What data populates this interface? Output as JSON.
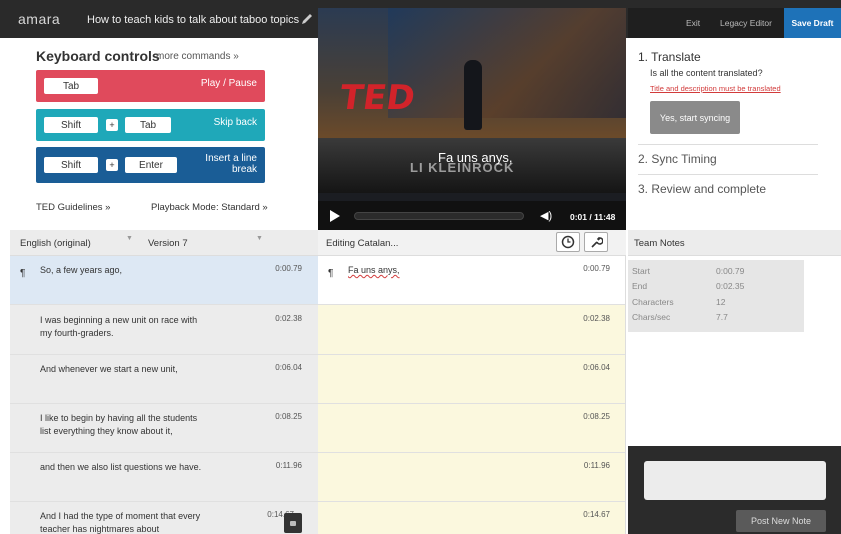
{
  "topbar": {
    "logo": "amara",
    "video_title": "How to teach kids to talk about taboo topics",
    "exit": "Exit",
    "legacy_editor": "Legacy Editor",
    "save_draft": "Save Draft"
  },
  "keyboard": {
    "title": "Keyboard controls",
    "more": "more commands »",
    "rows": [
      {
        "keys": [
          "Tab"
        ],
        "action": "Play / Pause",
        "color": "#e04a5c"
      },
      {
        "keys": [
          "Shift",
          "Tab"
        ],
        "action": "Skip back",
        "color": "#1fa8b9"
      },
      {
        "keys": [
          "Shift",
          "Enter"
        ],
        "action_line1": "Insert a line",
        "action_line2": "break",
        "color": "#1a5d96"
      }
    ],
    "plus": "+",
    "ted_guidelines": "TED Guidelines »",
    "playback_mode": "Playback Mode: Standard »"
  },
  "video": {
    "caption": "Fa uns anys,",
    "brand": "TED",
    "watermark": "LI KLEINROCK",
    "time": "0:01 / 11:48",
    "volume_icon": "volume-icon",
    "play_icon": "play-icon"
  },
  "workflow": {
    "step1": "1. Translate",
    "step1_question": "Is all the content translated?",
    "step1_warning": "Title and description must be translated",
    "sync_button": "Yes, start syncing",
    "step2": "2. Sync Timing",
    "step3": "3. Review and complete"
  },
  "headers": {
    "language": "English (original)",
    "version": "Version 7",
    "editing": "Editing Catalan...",
    "team_notes": "Team Notes",
    "caret": "▼"
  },
  "source_subtitles": [
    {
      "text": "So, a few years ago,",
      "time": "0:00.79"
    },
    {
      "text": "I was beginning a new unit on race with my fourth-graders.",
      "time": "0:02.38"
    },
    {
      "text": "And whenever we start a new unit,",
      "time": "0:06.04"
    },
    {
      "text": "I like to begin by having all the students list everything they know about it,",
      "time": "0:08.25"
    },
    {
      "text": "and then we also list questions we have.",
      "time": "0:11.96"
    },
    {
      "text": "And I had the type of moment that every teacher has nightmares about",
      "time": "0:14.67"
    }
  ],
  "target_subtitles": [
    {
      "text": "Fa uns anys,",
      "time": "0:00.79"
    },
    {
      "text": "",
      "time": "0:02.38"
    },
    {
      "text": "",
      "time": "0:06.04"
    },
    {
      "text": "",
      "time": "0:08.25"
    },
    {
      "text": "",
      "time": "0:11.96"
    },
    {
      "text": "",
      "time": "0:14.67"
    }
  ],
  "pilcrow": "¶",
  "stats": {
    "start_label": "Start",
    "start": "0:00.79",
    "end_label": "End",
    "end": "0:02.35",
    "chars_label": "Characters",
    "chars": "12",
    "cps_label": "Chars/sec",
    "cps": "7.7"
  },
  "notes": {
    "post": "Post New Note"
  }
}
